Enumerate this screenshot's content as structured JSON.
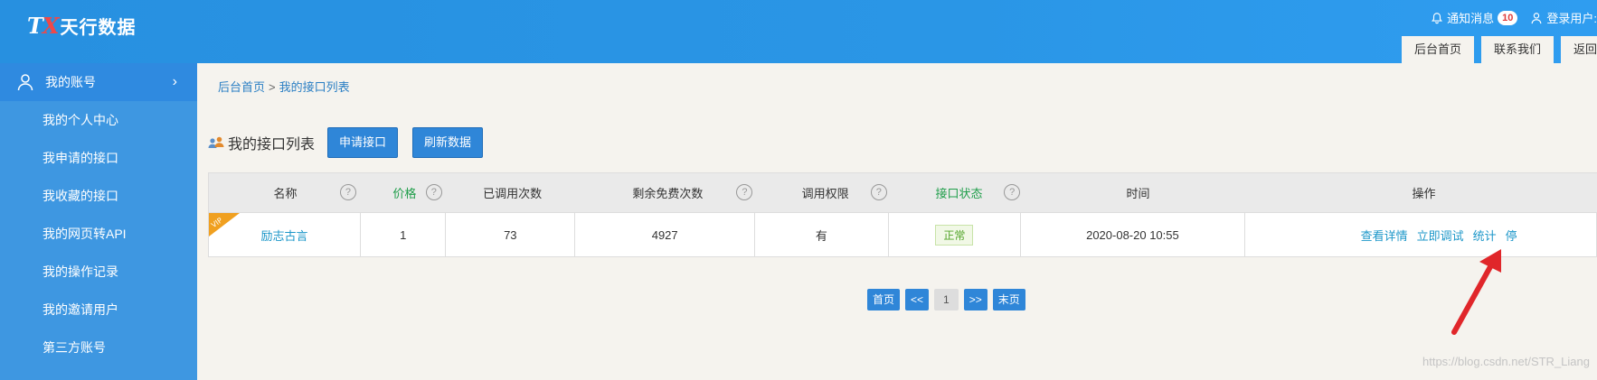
{
  "header": {
    "logo_mark_t": "T",
    "logo_mark_x": "X",
    "logo_text": "天行数据",
    "notice_label": "通知消息",
    "notice_count": "10",
    "login_label": "登录用户:",
    "tabs": [
      "后台首页",
      "联系我们",
      "返回"
    ]
  },
  "sidebar": {
    "head_label": "我的账号",
    "items": [
      "我的个人中心",
      "我申请的接口",
      "我收藏的接口",
      "我的网页转API",
      "我的操作记录",
      "我的邀请用户",
      "第三方账号"
    ]
  },
  "breadcrumb": {
    "home": "后台首页",
    "sep": ">",
    "current": "我的接口列表"
  },
  "toolbar": {
    "title": "我的接口列表",
    "apply_label": "申请接口",
    "refresh_label": "刷新数据"
  },
  "table": {
    "columns": [
      "名称",
      "价格",
      "已调用次数",
      "剩余免费次数",
      "调用权限",
      "接口状态",
      "时间",
      "操作"
    ],
    "help_glyph": "?",
    "row": {
      "name": "励志古言",
      "price": "1",
      "called": "73",
      "free_left": "4927",
      "permission": "有",
      "status": "正常",
      "time": "2020-08-20 10:55",
      "ops": [
        "查看详情",
        "立即调试",
        "统计",
        "停"
      ]
    },
    "vip_text": "VIP"
  },
  "pager": {
    "first": "首页",
    "prev": "<<",
    "current": "1",
    "next": ">>",
    "last": "末页"
  },
  "watermark": "https://blog.csdn.net/STR_Liang",
  "colors": {
    "header_blue": "#2a96e6",
    "sidebar_blue": "#3e97e1",
    "button_blue": "#2f86d8",
    "link_teal": "#1d97c9",
    "status_green": "#52a52a",
    "arrow_red": "#e0262a"
  }
}
